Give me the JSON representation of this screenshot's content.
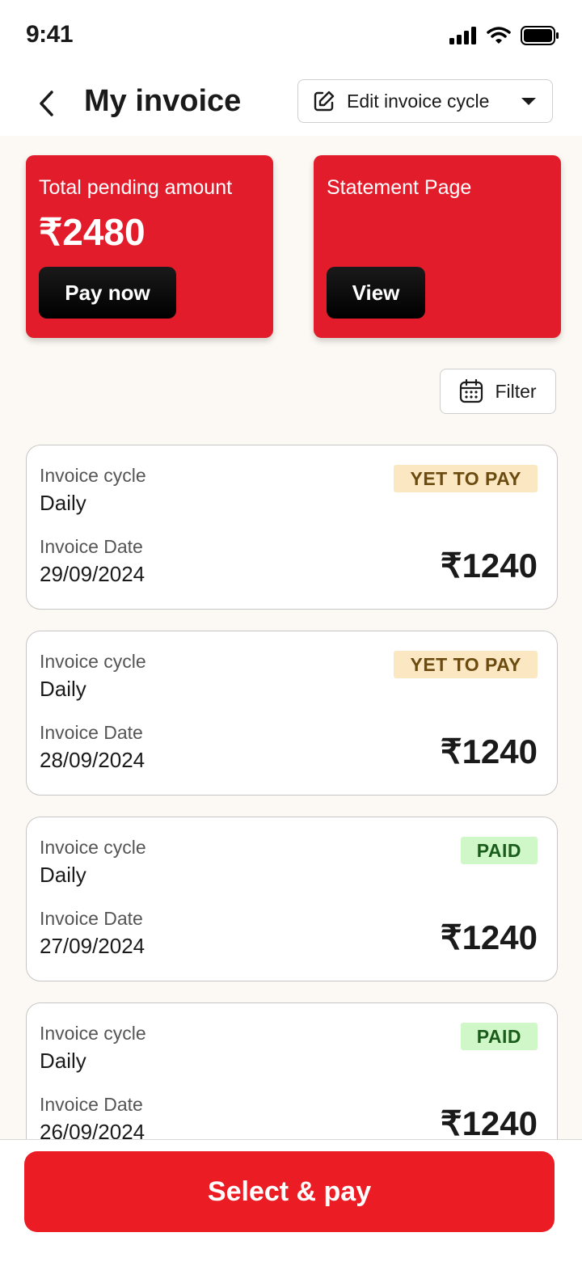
{
  "status_bar": {
    "time": "9:41"
  },
  "header": {
    "title": "My invoice",
    "edit_cycle_label": "Edit invoice cycle"
  },
  "summary": {
    "pending_label": "Total pending amount",
    "pending_amount": "₹2480",
    "pay_now_label": "Pay now",
    "statement_label": "Statement Page",
    "view_label": "View"
  },
  "filter": {
    "label": "Filter"
  },
  "invoices": [
    {
      "cycle_label": "Invoice cycle",
      "cycle": "Daily",
      "date_label": "Invoice Date",
      "date": "29/09/2024",
      "status": "YET TO PAY",
      "amount": "₹1240"
    },
    {
      "cycle_label": "Invoice cycle",
      "cycle": "Daily",
      "date_label": "Invoice Date",
      "date": "28/09/2024",
      "status": "YET TO PAY",
      "amount": "₹1240"
    },
    {
      "cycle_label": "Invoice cycle",
      "cycle": "Daily",
      "date_label": "Invoice Date",
      "date": "27/09/2024",
      "status": "PAID",
      "amount": "₹1240"
    },
    {
      "cycle_label": "Invoice cycle",
      "cycle": "Daily",
      "date_label": "Invoice Date",
      "date": "26/09/2024",
      "status": "PAID",
      "amount": "₹1240"
    }
  ],
  "bottom": {
    "select_pay_label": "Select & pay"
  },
  "colors": {
    "brand_red": "#e21c2b",
    "cta_red": "#ec1c24",
    "yet_to_pay_bg": "#fbe8c3",
    "paid_bg": "#cff7c8",
    "content_bg": "#fcf8f3"
  },
  "icons": [
    "signal-icon",
    "wifi-icon",
    "battery-icon",
    "back-arrow-icon",
    "edit-icon",
    "chevron-down-icon",
    "calendar-icon"
  ]
}
